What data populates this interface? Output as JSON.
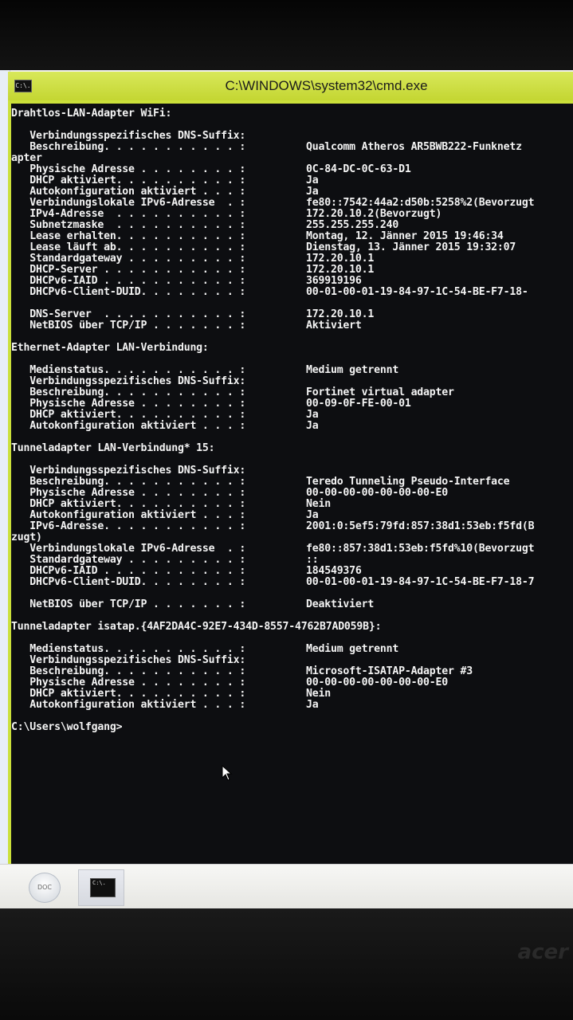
{
  "window": {
    "title": "C:\\WINDOWS\\system32\\cmd.exe",
    "icon_text": "C:\\."
  },
  "console": {
    "lines": [
      {
        "label": "Drahtlos-LAN-Adapter WiFi:",
        "value": ""
      },
      {
        "label": "",
        "value": ""
      },
      {
        "label": "   Verbindungsspezifisches DNS-Suffix:",
        "value": ""
      },
      {
        "label": "   Beschreibung. . . . . . . . . . . :",
        "value": "Qualcomm Atheros AR5BWB222-Funknetz"
      },
      {
        "label": "apter",
        "value": ""
      },
      {
        "label": "   Physische Adresse . . . . . . . . :",
        "value": "0C-84-DC-0C-63-D1"
      },
      {
        "label": "   DHCP aktiviert. . . . . . . . . . :",
        "value": "Ja"
      },
      {
        "label": "   Autokonfiguration aktiviert . . . :",
        "value": "Ja"
      },
      {
        "label": "   Verbindungslokale IPv6-Adresse  . :",
        "value": "fe80::7542:44a2:d50b:5258%2(Bevorzugt"
      },
      {
        "label": "   IPv4-Adresse  . . . . . . . . . . :",
        "value": "172.20.10.2(Bevorzugt)"
      },
      {
        "label": "   Subnetzmaske  . . . . . . . . . . :",
        "value": "255.255.255.240"
      },
      {
        "label": "   Lease erhalten. . . . . . . . . . :",
        "value": "Montag, 12. Jänner 2015 19:46:34"
      },
      {
        "label": "   Lease läuft ab. . . . . . . . . . :",
        "value": "Dienstag, 13. Jänner 2015 19:32:07"
      },
      {
        "label": "   Standardgateway . . . . . . . . . :",
        "value": "172.20.10.1"
      },
      {
        "label": "   DHCP-Server . . . . . . . . . . . :",
        "value": "172.20.10.1"
      },
      {
        "label": "   DHCPv6-IAID . . . . . . . . . . . :",
        "value": "369919196"
      },
      {
        "label": "   DHCPv6-Client-DUID. . . . . . . . :",
        "value": "00-01-00-01-19-84-97-1C-54-BE-F7-18-"
      },
      {
        "label": "",
        "value": ""
      },
      {
        "label": "   DNS-Server  . . . . . . . . . . . :",
        "value": "172.20.10.1"
      },
      {
        "label": "   NetBIOS über TCP/IP . . . . . . . :",
        "value": "Aktiviert"
      },
      {
        "label": "",
        "value": ""
      },
      {
        "label": "Ethernet-Adapter LAN-Verbindung:",
        "value": ""
      },
      {
        "label": "",
        "value": ""
      },
      {
        "label": "   Medienstatus. . . . . . . . . . . :",
        "value": "Medium getrennt"
      },
      {
        "label": "   Verbindungsspezifisches DNS-Suffix:",
        "value": ""
      },
      {
        "label": "   Beschreibung. . . . . . . . . . . :",
        "value": "Fortinet virtual adapter"
      },
      {
        "label": "   Physische Adresse . . . . . . . . :",
        "value": "00-09-0F-FE-00-01"
      },
      {
        "label": "   DHCP aktiviert. . . . . . . . . . :",
        "value": "Ja"
      },
      {
        "label": "   Autokonfiguration aktiviert . . . :",
        "value": "Ja"
      },
      {
        "label": "",
        "value": ""
      },
      {
        "label": "Tunneladapter LAN-Verbindung* 15:",
        "value": ""
      },
      {
        "label": "",
        "value": ""
      },
      {
        "label": "   Verbindungsspezifisches DNS-Suffix:",
        "value": ""
      },
      {
        "label": "   Beschreibung. . . . . . . . . . . :",
        "value": "Teredo Tunneling Pseudo-Interface"
      },
      {
        "label": "   Physische Adresse . . . . . . . . :",
        "value": "00-00-00-00-00-00-00-E0"
      },
      {
        "label": "   DHCP aktiviert. . . . . . . . . . :",
        "value": "Nein"
      },
      {
        "label": "   Autokonfiguration aktiviert . . . :",
        "value": "Ja"
      },
      {
        "label": "   IPv6-Adresse. . . . . . . . . . . :",
        "value": "2001:0:5ef5:79fd:857:38d1:53eb:f5fd(B"
      },
      {
        "label": "zugt)",
        "value": ""
      },
      {
        "label": "   Verbindungslokale IPv6-Adresse  . :",
        "value": "fe80::857:38d1:53eb:f5fd%10(Bevorzugt"
      },
      {
        "label": "   Standardgateway . . . . . . . . . :",
        "value": "::"
      },
      {
        "label": "   DHCPv6-IAID . . . . . . . . . . . :",
        "value": "184549376"
      },
      {
        "label": "   DHCPv6-Client-DUID. . . . . . . . :",
        "value": "00-01-00-01-19-84-97-1C-54-BE-F7-18-7"
      },
      {
        "label": "",
        "value": ""
      },
      {
        "label": "   NetBIOS über TCP/IP . . . . . . . :",
        "value": "Deaktiviert"
      },
      {
        "label": "",
        "value": ""
      },
      {
        "label": "Tunneladapter isatap.{4AF2DA4C-92E7-434D-8557-4762B7AD059B}:",
        "value": ""
      },
      {
        "label": "",
        "value": ""
      },
      {
        "label": "   Medienstatus. . . . . . . . . . . :",
        "value": "Medium getrennt"
      },
      {
        "label": "   Verbindungsspezifisches DNS-Suffix:",
        "value": ""
      },
      {
        "label": "   Beschreibung. . . . . . . . . . . :",
        "value": "Microsoft-ISATAP-Adapter #3"
      },
      {
        "label": "   Physische Adresse . . . . . . . . :",
        "value": "00-00-00-00-00-00-00-E0"
      },
      {
        "label": "   DHCP aktiviert. . . . . . . . . . :",
        "value": "Nein"
      },
      {
        "label": "   Autokonfiguration aktiviert . . . :",
        "value": "Ja"
      },
      {
        "label": "",
        "value": ""
      },
      {
        "label": "C:\\Users\\wolfgang>",
        "value": ""
      }
    ]
  },
  "taskbar": {
    "doc_button_label": "DOC",
    "cmd_icon_text": "C:\\."
  },
  "bezel": {
    "brand": "acer"
  }
}
